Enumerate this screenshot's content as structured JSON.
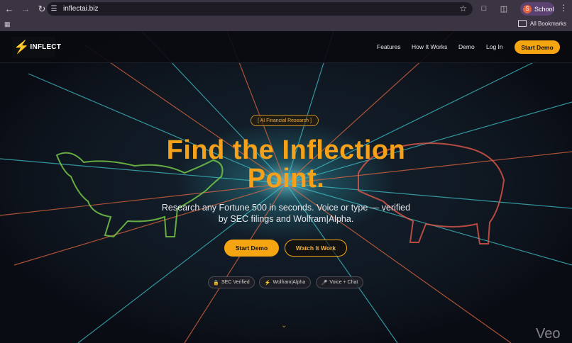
{
  "browser": {
    "url": "inflectai.biz",
    "profile_name": "School",
    "profile_initial": "S",
    "bookmarks_label": "All Bookmarks"
  },
  "site": {
    "logo_text": "INFLECT",
    "nav": [
      "Features",
      "How It Works",
      "Demo",
      "Log In"
    ],
    "nav_cta": "Start Demo",
    "tag": "[ AI Financial Research ]",
    "headline_line1": "Find the Inflection",
    "headline_line2": "Point.",
    "subhead_line1": "Research any Fortune 500 in seconds. Voice or type — verified",
    "subhead_line2": "by SEC filings and Wolfram|Alpha.",
    "primary_button": "Start Demo",
    "secondary_button": "Watch It Work",
    "badges": [
      {
        "icon": "lock-icon",
        "label": "SEC Verified"
      },
      {
        "icon": "bolt-icon",
        "label": "Wolfram|Alpha"
      },
      {
        "icon": "microphone-icon",
        "label": "Voice + Chat"
      }
    ],
    "watermark": "Veo",
    "colors": {
      "accent": "#f5a511",
      "headline": "#f6a11a",
      "background": "#0b0d14"
    }
  }
}
